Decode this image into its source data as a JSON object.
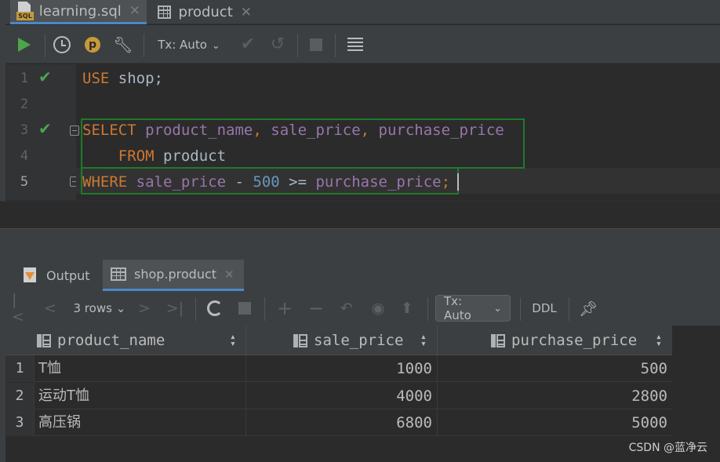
{
  "editor_tabs": [
    {
      "label": "learning.sql",
      "icon": "sql-file-icon",
      "active": true
    },
    {
      "label": "product",
      "icon": "table-icon",
      "active": false
    }
  ],
  "editor_toolbar": {
    "tx_label": "Tx: Auto"
  },
  "editor": {
    "line_numbers": [
      "1",
      "2",
      "3",
      "4",
      "5"
    ],
    "lines": [
      [
        {
          "t": "USE",
          "c": "kw"
        },
        {
          "t": " shop;",
          "c": "pl"
        }
      ],
      [],
      [
        {
          "t": "SELECT",
          "c": "kw"
        },
        {
          "t": " ",
          "c": "pl"
        },
        {
          "t": "product_name",
          "c": "id"
        },
        {
          "t": ", ",
          "c": "kw"
        },
        {
          "t": "sale_price",
          "c": "id"
        },
        {
          "t": ", ",
          "c": "kw"
        },
        {
          "t": "purchase_price",
          "c": "id"
        }
      ],
      [
        {
          "t": "    ",
          "c": "pl"
        },
        {
          "t": "FROM",
          "c": "kw"
        },
        {
          "t": " product",
          "c": "pl"
        }
      ],
      [
        {
          "t": "WHERE",
          "c": "kw"
        },
        {
          "t": " ",
          "c": "pl"
        },
        {
          "t": "sale_price",
          "c": "id"
        },
        {
          "t": " - ",
          "c": "pl"
        },
        {
          "t": "500",
          "c": "nm"
        },
        {
          "t": " >= ",
          "c": "pl"
        },
        {
          "t": "purchase_price",
          "c": "id"
        },
        {
          "t": ";",
          "c": "kw"
        }
      ]
    ],
    "executed_lines": [
      "1",
      "3"
    ],
    "current_line": "5"
  },
  "services_tabs": [
    {
      "label": "Output",
      "icon": "output-icon",
      "active": false
    },
    {
      "label": "shop.product",
      "icon": "table-icon",
      "active": true
    }
  ],
  "results_toolbar": {
    "rows_label": "3 rows",
    "tx_label": "Tx: Auto",
    "ddl_label": "DDL"
  },
  "results": {
    "columns": [
      "product_name",
      "sale_price",
      "purchase_price"
    ],
    "rows": [
      {
        "n": "1",
        "product_name": "T恤",
        "sale_price": "1000",
        "purchase_price": "500"
      },
      {
        "n": "2",
        "product_name": "运动T恤",
        "sale_price": "4000",
        "purchase_price": "2800"
      },
      {
        "n": "3",
        "product_name": "高压锅",
        "sale_price": "6800",
        "purchase_price": "5000"
      }
    ]
  },
  "watermark": "CSDN @蓝净云",
  "colors": {
    "keyword": "#cc7832",
    "identifier": "#9876aa",
    "number": "#6897bb",
    "plain": "#a9b7c6",
    "run_green": "#4ca64c",
    "tab_accent": "#4a88c7"
  }
}
